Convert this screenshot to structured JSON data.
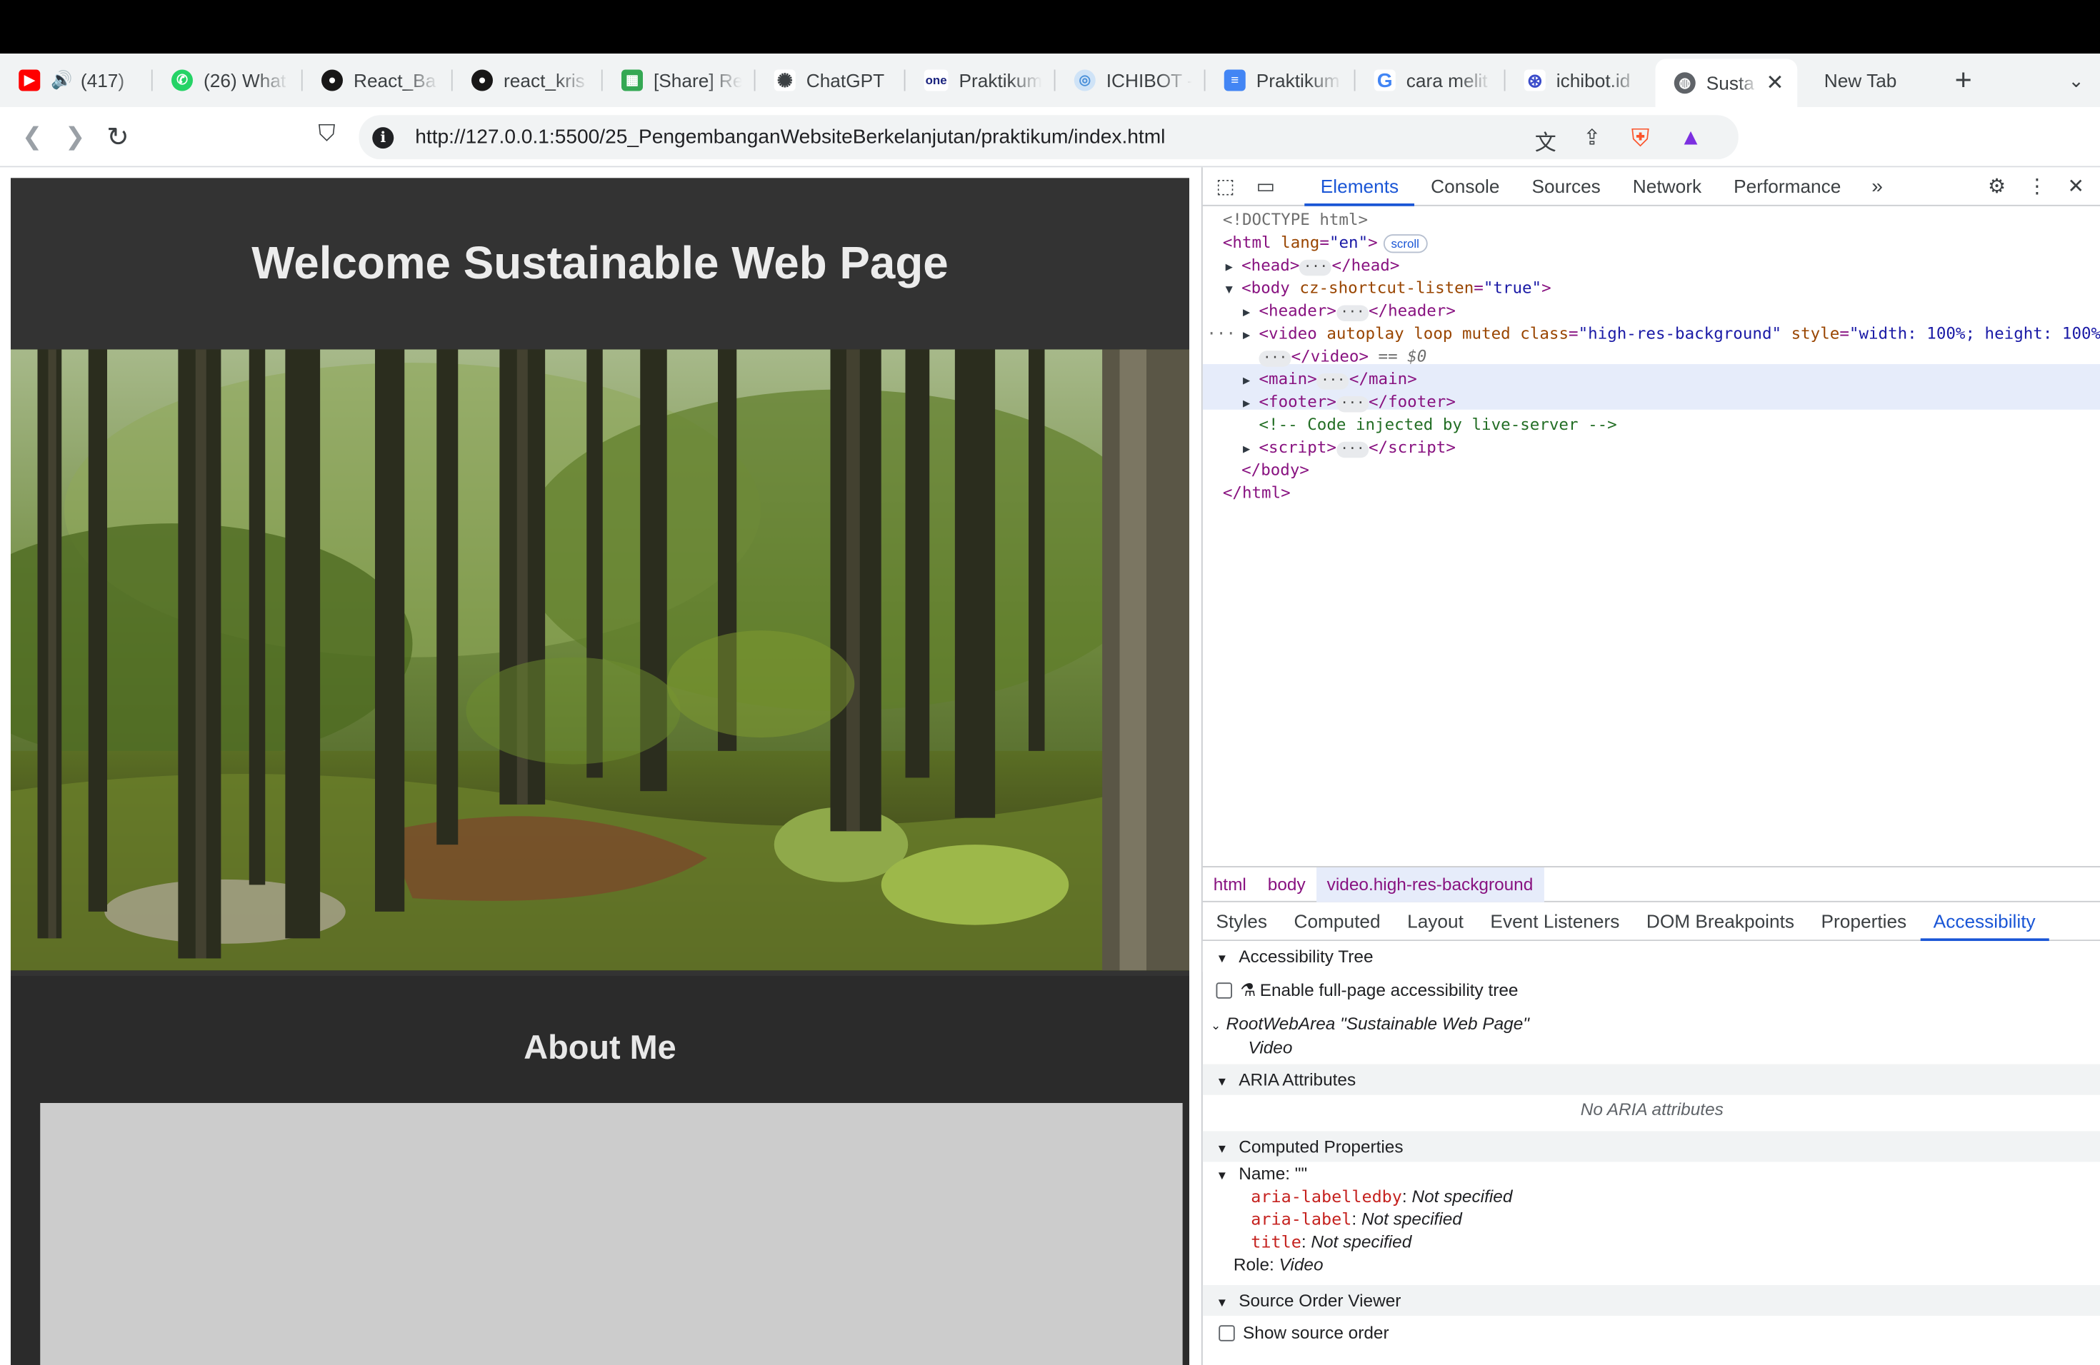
{
  "browser": {
    "tabs": [
      {
        "title": "(417)",
        "favicon": "youtube-icon",
        "color": "#ff0000"
      },
      {
        "title": "(26) What",
        "favicon": "whatsapp-icon",
        "color": "#25d366"
      },
      {
        "title": "React_Ba",
        "favicon": "github-icon",
        "color": "#181717"
      },
      {
        "title": "react_kris",
        "favicon": "github-icon",
        "color": "#181717"
      },
      {
        "title": "[Share] Re",
        "favicon": "sheets-icon",
        "color": "#34a853"
      },
      {
        "title": "ChatGPT",
        "favicon": "chatgpt-icon",
        "color": "#3c4043"
      },
      {
        "title": "Praktikum",
        "favicon": "one-icon",
        "color": "#1a237e"
      },
      {
        "title": "ICHIBOT -",
        "favicon": "ichibot-icon",
        "color": "#4a90d9"
      },
      {
        "title": "Praktikum",
        "favicon": "docs-icon",
        "color": "#4285f4"
      },
      {
        "title": "cara melit",
        "favicon": "google-icon",
        "color": "#4285f4"
      },
      {
        "title": "ichibot.id",
        "favicon": "ichibot-icon",
        "color": "#3b4cca"
      },
      {
        "title": "Susta",
        "favicon": "globe-icon",
        "color": "#5f6368",
        "active": true
      },
      {
        "title": "New Tab",
        "favicon": "",
        "color": ""
      }
    ],
    "url": "http://127.0.0.1:5500/25_PengembanganWebsiteBerkelanjutan/praktikum/index.html"
  },
  "page": {
    "title": "Welcome Sustainable Web Page",
    "about_title": "About Me"
  },
  "devtools": {
    "tabs": [
      "Elements",
      "Console",
      "Sources",
      "Network",
      "Performance"
    ],
    "active_tab": "Elements",
    "dom": {
      "doctype": "<!DOCTYPE html>",
      "scroll_badge": "scroll",
      "selected_suffix": "== $0",
      "comment": "<!-- Code injected by live-server -->"
    },
    "breadcrumbs": [
      "html",
      "body",
      "video.high-res-background"
    ],
    "subtabs": [
      "Styles",
      "Computed",
      "Layout",
      "Event Listeners",
      "DOM Breakpoints",
      "Properties",
      "Accessibility"
    ],
    "active_subtab": "Accessibility",
    "accessibility": {
      "tree_header": "Accessibility Tree",
      "enable_label": "Enable full-page accessibility tree",
      "root_area": "RootWebArea \"Sustainable Web Page\"",
      "root_child": "Video",
      "aria_header": "ARIA Attributes",
      "no_aria": "No ARIA attributes",
      "computed_header": "Computed Properties",
      "name_label": "Name: \"\"",
      "labelledby_key": "aria-labelledby",
      "labelledby_val": "Not specified",
      "label_key": "aria-label",
      "label_val": "Not specified",
      "title_key": "title",
      "title_val": "Not specified",
      "role_label": "Role:",
      "role_val": "Video",
      "source_order_header": "Source Order Viewer",
      "show_source_order": "Show source order"
    }
  }
}
